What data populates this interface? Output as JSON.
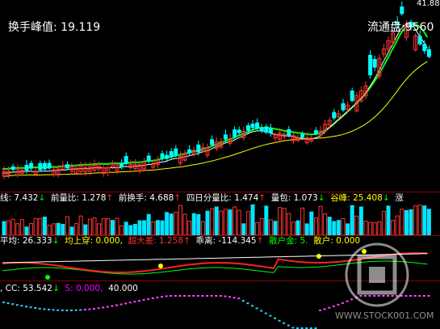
{
  "main": {
    "turnover_peak_label": "换手峰值:",
    "turnover_peak_value": "19.119",
    "float_cap_label": "流通盘:",
    "float_cap_value": "9560",
    "top_price": "41.88",
    "colors": {
      "ma_short": "#ffffff",
      "ma_mid": "#00ff00",
      "ma_long": "#ffff00",
      "up": "#ff3333",
      "down": "#00ffff"
    }
  },
  "volume_bar": {
    "segments": [
      {
        "text": "线: 7.432",
        "arrow": "↓",
        "color": "#ffffff",
        "arrow_color": "#00ff00"
      },
      {
        "text": "前量比: 1.278",
        "arrow": "↑",
        "color": "#ffffff",
        "arrow_color": "#ff3333"
      },
      {
        "text": "前换手: 4.688",
        "arrow": "↑",
        "color": "#ffffff",
        "arrow_color": "#ff3333"
      },
      {
        "text": "四日分量比: 1.474",
        "arrow": "↑",
        "color": "#ffffff",
        "arrow_color": "#ff3333"
      },
      {
        "text": "量包: 1.073",
        "arrow": "↓",
        "color": "#ffffff",
        "arrow_color": "#00ff00"
      },
      {
        "text": "谷峰: 25.408",
        "arrow": "↓",
        "color": "#ffff00",
        "arrow_color": "#00ff00"
      },
      {
        "text": "涨",
        "arrow": "",
        "color": "#ffffff",
        "arrow_color": "#ffffff"
      }
    ]
  },
  "indicator1": {
    "segments": [
      {
        "text": "平均: 26.333",
        "arrow": "↓",
        "color": "#ffffff",
        "arrow_color": "#00ff00"
      },
      {
        "text": "均上穿: 0.000",
        "arrow": ",",
        "color": "#ffff00",
        "arrow_color": "#ffff00"
      },
      {
        "text": "超大差: 1.258",
        "arrow": "↑",
        "color": "#ff3333",
        "arrow_color": "#ff3333"
      },
      {
        "text": "乖离: -114.345",
        "arrow": "↑",
        "color": "#ffffff",
        "arrow_color": "#ff3333"
      },
      {
        "text": "散户金: 5.",
        "arrow": "",
        "color": "#00ff00",
        "arrow_color": "#00ff00"
      },
      {
        "text": "散户: 0.000",
        "arrow": "",
        "color": "#ffff00",
        "arrow_color": "#ffff00"
      }
    ]
  },
  "indicator2": {
    "segments": [
      {
        "text": ", CC: 53.542",
        "arrow": "↓",
        "color": "#ffffff",
        "arrow_color": "#00ff00"
      },
      {
        "text": "S: 0.000",
        "arrow": ",",
        "color": "#ff00ff",
        "arrow_color": "#ff00ff"
      },
      {
        "text": "40.000",
        "arrow": "",
        "color": "#ffffff",
        "arrow_color": "#ffffff"
      }
    ]
  },
  "watermark": {
    "text": "WWW.STOCK001.COM",
    "color": "#ffffff"
  }
}
